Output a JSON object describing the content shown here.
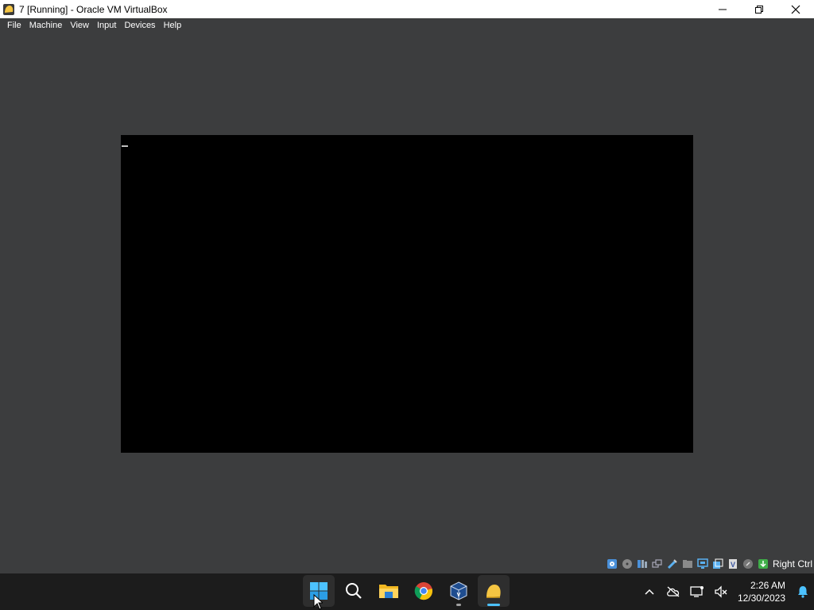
{
  "window": {
    "title": "7 [Running] - Oracle VM VirtualBox"
  },
  "menubar": {
    "items": [
      {
        "label": "File"
      },
      {
        "label": "Machine"
      },
      {
        "label": "View"
      },
      {
        "label": "Input"
      },
      {
        "label": "Devices"
      },
      {
        "label": "Help"
      }
    ]
  },
  "statusbar": {
    "icons": [
      "hard-disk-icon",
      "optical-drive-icon",
      "audio-icon",
      "network-icon",
      "usb-icon",
      "shared-folders-icon",
      "display-icon",
      "recording-icon",
      "vt-x-icon",
      "mouse-integration-icon",
      "keyboard-capture-icon"
    ],
    "host_key": "Right Ctrl"
  },
  "taskbar": {
    "apps": [
      "start-button",
      "search-button",
      "file-explorer",
      "chrome",
      "virtualbox-manager",
      "virtualbox-vm"
    ],
    "time": "2:26 AM",
    "date": "12/30/2023"
  },
  "colors": {
    "window_bg": "#3c3d3e",
    "taskbar_bg": "#1c1c1c",
    "accent": "#4cc2ff"
  }
}
